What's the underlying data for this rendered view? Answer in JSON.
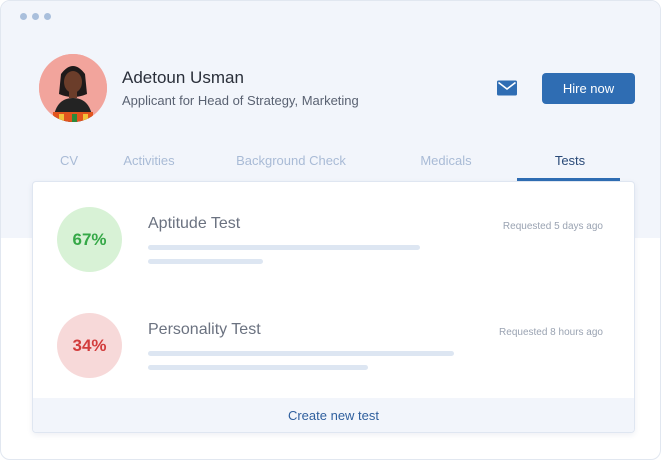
{
  "window": {
    "dots": [
      "dot",
      "dot",
      "dot"
    ]
  },
  "header": {
    "name": "Adetoun Usman",
    "role": "Applicant for Head of Strategy, Marketing",
    "mail_icon": "envelope-icon",
    "hire_label": "Hire now"
  },
  "tabs": [
    {
      "label": "CV",
      "active": false
    },
    {
      "label": "Activities",
      "active": false
    },
    {
      "label": "Background Check",
      "active": false
    },
    {
      "label": "Medicals",
      "active": false
    },
    {
      "label": "Tests",
      "active": true
    }
  ],
  "tests": [
    {
      "score": "67%",
      "title": "Aptitude Test",
      "requested": "Requested 5 days ago",
      "status": "good"
    },
    {
      "score": "34%",
      "title": "Personality Test",
      "requested": "Requested 8 hours ago",
      "status": "bad"
    }
  ],
  "footer": {
    "create_label": "Create new test"
  },
  "colors": {
    "accent": "#2f6db3",
    "good": "#35a847",
    "bad": "#d23c3c",
    "band": "#f2f5fb"
  }
}
